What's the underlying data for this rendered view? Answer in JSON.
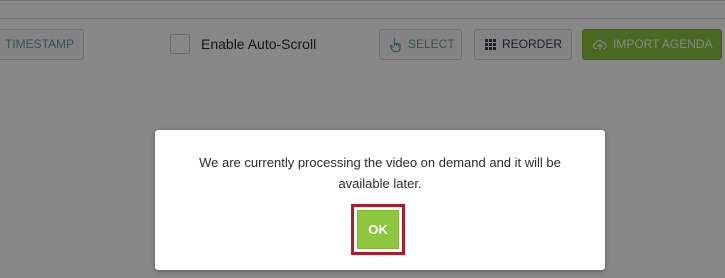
{
  "toolbar": {
    "timestamp_label": "TIMESTAMP",
    "auto_scroll_label": "Enable Auto-Scroll",
    "auto_scroll_checked": false,
    "select_label": "SELECT",
    "reorder_label": "REORDER",
    "import_agenda_label": "IMPORT AGENDA",
    "icons": {
      "select": "pointer-hand-icon",
      "reorder": "grid-dots-icon",
      "import_agenda": "cloud-upload-icon"
    }
  },
  "modal": {
    "message": "We are currently processing the video on demand and it will be available later.",
    "ok_label": "OK"
  },
  "colors": {
    "accent_green": "#8bc53f",
    "highlight_red": "#b5182b",
    "overlay": "rgba(0,0,0,0.47)"
  }
}
